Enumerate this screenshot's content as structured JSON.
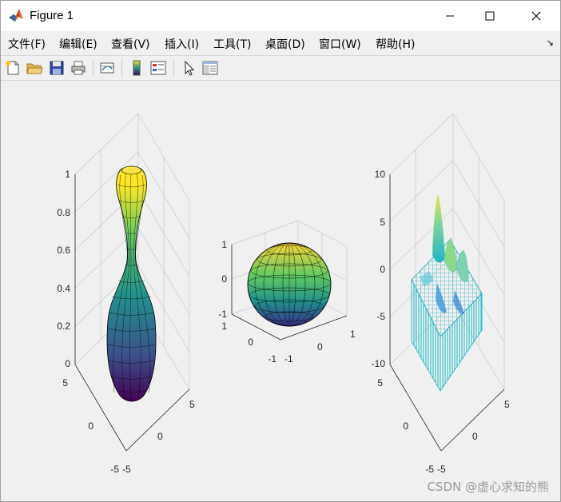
{
  "window": {
    "title": "Figure 1",
    "minimize_label": "—",
    "maximize_label": "☐",
    "close_label": "✕"
  },
  "menu": {
    "items": [
      {
        "label": "文件(F)",
        "name": "file"
      },
      {
        "label": "编辑(E)",
        "name": "edit"
      },
      {
        "label": "查看(V)",
        "name": "view"
      },
      {
        "label": "插入(I)",
        "name": "insert"
      },
      {
        "label": "工具(T)",
        "name": "tools"
      },
      {
        "label": "桌面(D)",
        "name": "desktop"
      },
      {
        "label": "窗口(W)",
        "name": "window"
      },
      {
        "label": "帮助(H)",
        "name": "help"
      }
    ],
    "dock_arrow": "↘"
  },
  "toolbar": {
    "icons": [
      "new-figure-icon",
      "open-file-icon",
      "save-icon",
      "print-icon",
      "link-plot-icon",
      "colorbar-icon",
      "legend-icon",
      "pointer-icon",
      "property-inspector-icon"
    ]
  },
  "colors": {
    "colormap": [
      "#440154",
      "#3b528b",
      "#21918c",
      "#5ec962",
      "#fde725"
    ],
    "cyan_surface": "#22c3c3",
    "axes_line": "#b5b5b5"
  },
  "subplots": [
    {
      "name": "vase-surface",
      "z_ticks": [
        "1",
        "0.8",
        "0.6",
        "0.4",
        "0.2",
        "0"
      ],
      "y_ticks": [
        "5",
        "0",
        "-5"
      ],
      "x_ticks": [
        "-5",
        "0",
        "5"
      ]
    },
    {
      "name": "sphere-surface",
      "z_ticks": [
        "1",
        "0",
        "-1"
      ],
      "y_ticks": [
        "1",
        "0",
        "-1"
      ],
      "x_ticks": [
        "-1",
        "0",
        "1"
      ]
    },
    {
      "name": "peaks-mesh",
      "z_ticks": [
        "10",
        "5",
        "0",
        "-5",
        "-10"
      ],
      "y_ticks": [
        "5",
        "0",
        "-5"
      ],
      "x_ticks": [
        "-5",
        "0",
        "5"
      ]
    }
  ],
  "watermark": "CSDN @虚心求知的熊"
}
